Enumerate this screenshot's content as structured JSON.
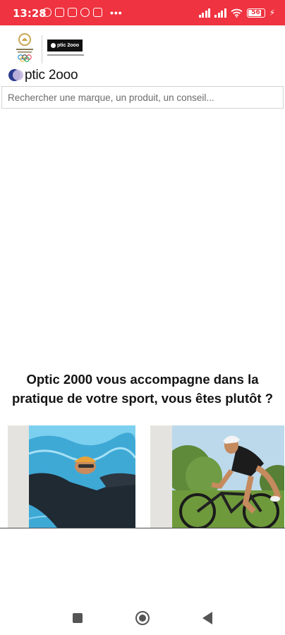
{
  "status_bar": {
    "time": "13:28",
    "overflow_dots": "•••",
    "battery_level": "56",
    "icons": [
      "alarm-icon",
      "sim-icon",
      "app-icon",
      "facebook-icon",
      "gmail-icon",
      "signal-icon",
      "wifi-icon",
      "battery-icon",
      "charging-icon"
    ]
  },
  "header": {
    "brand_name": "ptic 2ooo",
    "sponsor_badge_text": "ptic 2ooo"
  },
  "search": {
    "placeholder": "Rechercher une marque, un produit, un conseil..."
  },
  "main": {
    "heading_line1": "Optic 2000 vous accompagne dans la",
    "heading_line2": "pratique de votre sport, vous êtes plutôt ?",
    "cards": [
      {
        "image": "swimmer-photo"
      },
      {
        "image": "cyclist-photo"
      }
    ]
  },
  "nav_bar": {
    "buttons": [
      "recent-apps-button",
      "home-button",
      "back-button"
    ]
  },
  "colors": {
    "status_bar": "#ef3340",
    "brand_navy": "#2b3b8f",
    "brand_lilac": "#c7b8e0",
    "olympic_gold": "#c9a653",
    "card_bg": "#e4e3df"
  }
}
